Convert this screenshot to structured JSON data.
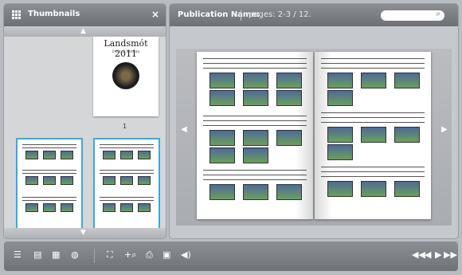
{
  "sidebar": {
    "title": "Thumbnails",
    "close_label": "×",
    "cover": {
      "title": "Landsmót 2011",
      "subtitle": "Úrslit og Þátttaka",
      "page_number": "1"
    }
  },
  "header": {
    "publication_label": "Publication Name:",
    "pages_label": "pages:",
    "pages_value": "2-3",
    "pages_separator": "/",
    "pages_total": "12."
  },
  "toolbar": {
    "icons": [
      "list-icon",
      "page-icon",
      "thumbnails-icon",
      "globe-icon",
      "fullscreen-icon",
      "zoom-in-icon",
      "print-icon",
      "save-icon",
      "sound-icon",
      "first-icon",
      "previous-icon",
      "next-icon",
      "last-icon"
    ]
  },
  "icons": {
    "search": "search-icon",
    "prev_page": "prev-page-icon",
    "next_page": "next-page-icon"
  }
}
